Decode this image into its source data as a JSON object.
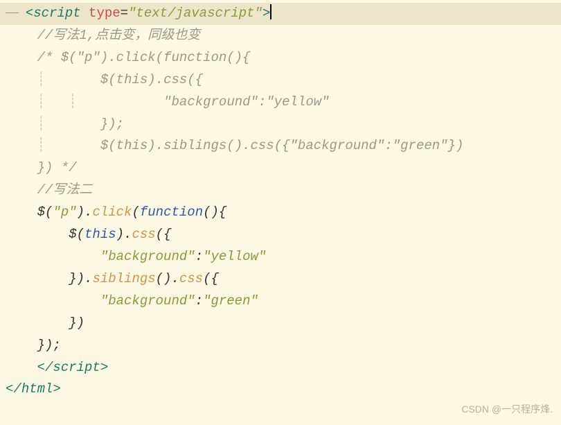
{
  "code": {
    "l1_open": "<",
    "l1_tag": "script",
    "l1_space": " ",
    "l1_attr": "type",
    "l1_eq": "=",
    "l1_val": "\"text/javascript\"",
    "l1_close": ">",
    "l2": "//写法1,点击变，同级也变",
    "l3": "/* $(\"p\").click(function(){",
    "l4": "    $(this).css({",
    "l5": "        \"background\":\"yellow\"",
    "l6": "    });",
    "l7": "    $(this).siblings().css({\"background\":\"green\"})",
    "l8": "}) */",
    "l9": "//写法二",
    "l10_dollar": "$",
    "l10_p1": "(",
    "l10_str": "\"p\"",
    "l10_p2": ").",
    "l10_click": "click",
    "l10_p3": "(",
    "l10_func": "function",
    "l10_p4": "(){",
    "l11_dollar": "$",
    "l11_p1": "(",
    "l11_this": "this",
    "l11_p2": ").",
    "l11_css": "css",
    "l11_p3": "({",
    "l12_key": "\"background\"",
    "l12_colon": ":",
    "l12_val": "\"yellow\"",
    "l13_close": "}).",
    "l13_sib": "siblings",
    "l13_p1": "().",
    "l13_css": "css",
    "l13_p2": "({",
    "l14_key": "\"background\"",
    "l14_colon": ":",
    "l14_val": "\"green\"",
    "l15": "})",
    "l16": "});",
    "l17_open": "</",
    "l17_tag": "script",
    "l17_close": ">",
    "l18_open": "</",
    "l18_tag": "html",
    "l18_close": ">"
  },
  "fold": "—— ",
  "watermark": "CSDN @一只程序烽."
}
